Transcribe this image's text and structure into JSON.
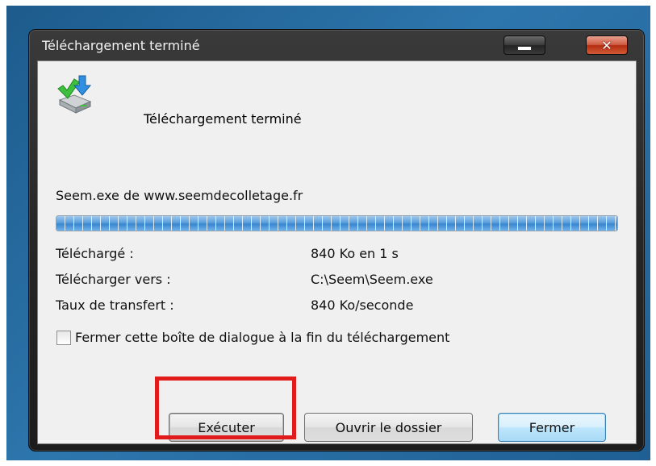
{
  "window": {
    "title": "Téléchargement terminé",
    "controls": {
      "minimize_icon": "minimize-icon",
      "close_icon": "close-icon",
      "close_symbol": "✕"
    }
  },
  "dialog": {
    "heading": "Téléchargement terminé",
    "icon": "download-complete-icon",
    "source": "Seem.exe de www.seemdecolletage.fr",
    "progress_fraction": 1.0,
    "details": [
      {
        "label": "Téléchargé :",
        "value": "840 Ko en 1 s"
      },
      {
        "label": "Télécharger vers :",
        "value": "C:\\Seem\\Seem.exe"
      },
      {
        "label": "Taux de transfert :",
        "value": "840 Ko/seconde"
      }
    ],
    "checkbox_label": "Fermer cette boîte de dialogue à la fin du téléchargement",
    "checkbox_checked": false,
    "buttons": {
      "execute": "Exécuter",
      "open_folder": "Ouvrir le dossier",
      "close": "Fermer"
    }
  },
  "colors": {
    "highlight": "#e11b1b",
    "progress": "#3a86cf",
    "desktop": "#2d76ad"
  }
}
